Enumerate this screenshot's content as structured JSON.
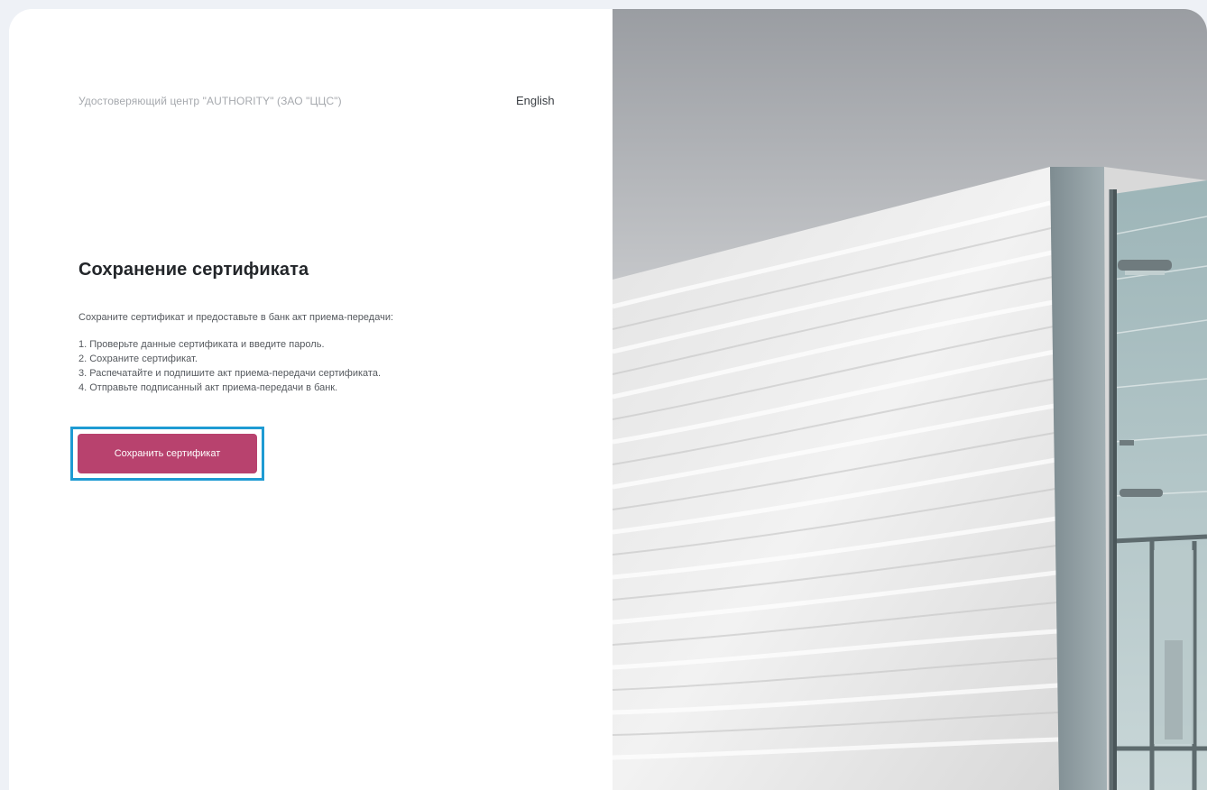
{
  "header": {
    "org_name": "Удостоверяющий центр \"AUTHORITY\" (ЗАО \"ЦЦС\")",
    "language_link": "English"
  },
  "main": {
    "title": "Сохранение сертификата",
    "intro": "Сохраните сертификат и предоставьте в банк акт приема-передачи:",
    "steps": [
      "1. Проверьте данные сертификата и введите пароль.",
      "2. Сохраните сертификат.",
      "3. Распечатайте и подпишите акт приема-передачи сертификата.",
      "4. Отправьте подписанный акт приема-передачи в банк."
    ],
    "save_button_label": "Сохранить сертификат"
  },
  "colors": {
    "accent": "#b8426e",
    "highlight": "#1f9bd3",
    "background": "#eef1f6"
  }
}
